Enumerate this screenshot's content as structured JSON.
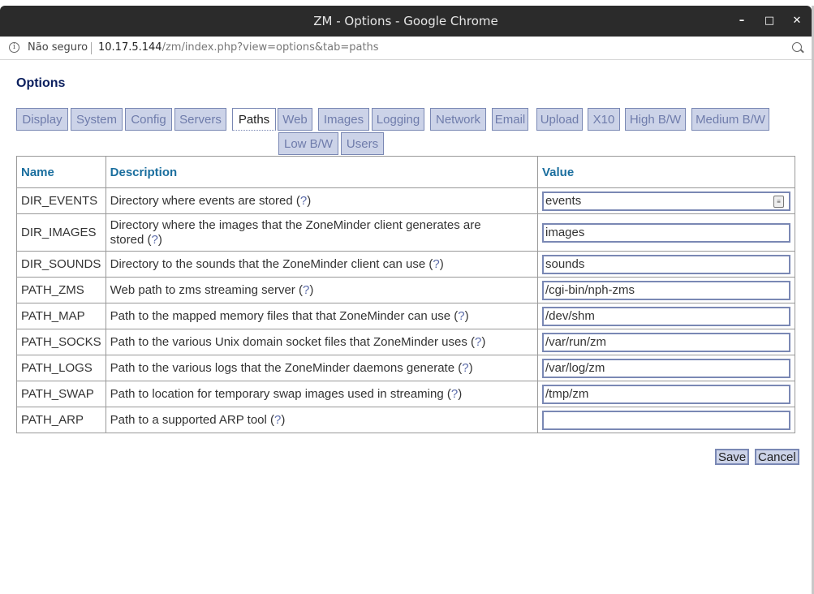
{
  "window": {
    "title": "ZM - Options - Google Chrome",
    "minimize": "–",
    "maximize": "□",
    "close": "✕"
  },
  "address_bar": {
    "security_label": "Não seguro",
    "url_host": "10.17.5.144",
    "url_path": "/zm/index.php?view=options&tab=paths"
  },
  "page": {
    "title": "Options",
    "tabs": [
      {
        "label": "Display"
      },
      {
        "label": "System"
      },
      {
        "label": "Config"
      },
      {
        "label": "Servers"
      },
      {
        "label": "Paths",
        "active": true
      },
      {
        "label": "Web"
      },
      {
        "label": "Images"
      },
      {
        "label": "Logging"
      },
      {
        "label": "Network"
      },
      {
        "label": "Email"
      },
      {
        "label": "Upload"
      },
      {
        "label": "X10"
      },
      {
        "label": "High B/W"
      },
      {
        "label": "Medium B/W"
      },
      {
        "label": "Low B/W"
      },
      {
        "label": "Users"
      }
    ],
    "table": {
      "headers": {
        "name": "Name",
        "description": "Description",
        "value": "Value"
      },
      "help_mark": "?",
      "rows": [
        {
          "name": "DIR_EVENTS",
          "description": "Directory where events are stored",
          "value": "events"
        },
        {
          "name": "DIR_IMAGES",
          "description": "Directory where the images that the ZoneMinder client generates are",
          "description2": "stored",
          "value": "images"
        },
        {
          "name": "DIR_SOUNDS",
          "description": "Directory to the sounds that the ZoneMinder client can use",
          "value": "sounds"
        },
        {
          "name": "PATH_ZMS",
          "description": "Web path to zms streaming server",
          "value": "/cgi-bin/nph-zms"
        },
        {
          "name": "PATH_MAP",
          "description": "Path to the mapped memory files that that ZoneMinder can use",
          "value": "/dev/shm"
        },
        {
          "name": "PATH_SOCKS",
          "description": "Path to the various Unix domain socket files that ZoneMinder uses",
          "value": "/var/run/zm"
        },
        {
          "name": "PATH_LOGS",
          "description": "Path to the various logs that the ZoneMinder daemons generate",
          "value": "/var/log/zm"
        },
        {
          "name": "PATH_SWAP",
          "description": "Path to location for temporary swap images used in streaming",
          "value": "/tmp/zm"
        },
        {
          "name": "PATH_ARP",
          "description": "Path to a supported ARP tool",
          "value": ""
        }
      ]
    },
    "buttons": {
      "save": "Save",
      "cancel": "Cancel"
    }
  },
  "colors": {
    "tab_bg": "#ccd3e8",
    "tab_text": "#6f7cab",
    "header_text": "#1a6e9e",
    "title_text": "#0b1f5e"
  }
}
